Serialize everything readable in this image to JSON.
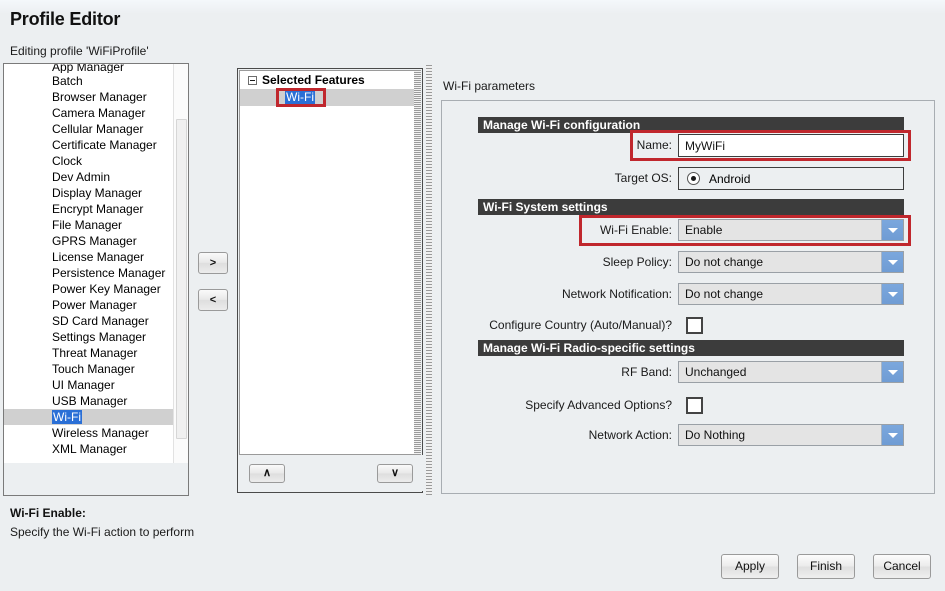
{
  "window": {
    "title": "Profile Editor",
    "subtitle": "Editing profile 'WiFiProfile'"
  },
  "feature_list": {
    "clipped_top_item": "App Manager",
    "items": [
      "Batch",
      "Browser Manager",
      "Camera Manager",
      "Cellular Manager",
      "Certificate Manager",
      "Clock",
      "Dev Admin",
      "Display Manager",
      "Encrypt Manager",
      "File Manager",
      "GPRS Manager",
      "License Manager",
      "Persistence Manager",
      "Power Key Manager",
      "Power Manager",
      "SD Card Manager",
      "Settings Manager",
      "Threat Manager",
      "Touch Manager",
      "UI Manager",
      "USB Manager",
      "Wi-Fi",
      "Wireless Manager",
      "XML Manager"
    ],
    "selected": "Wi-Fi"
  },
  "transfer": {
    "add_label": ">",
    "remove_label": "<"
  },
  "selected_features": {
    "root_label": "Selected Features",
    "children": [
      "Wi-Fi"
    ],
    "move_up_label": "∧",
    "move_down_label": "∨"
  },
  "params": {
    "title": "Wi-Fi parameters",
    "sections": [
      {
        "header": "Manage Wi-Fi configuration",
        "fields": [
          {
            "label": "Name:",
            "type": "text",
            "value": "MyWiFi",
            "highlighted": true
          },
          {
            "label": "Target OS:",
            "type": "radio",
            "value": "Android",
            "highlighted": false
          }
        ]
      },
      {
        "header": "Wi-Fi System settings",
        "fields": [
          {
            "label": "Wi-Fi Enable:",
            "type": "combo",
            "value": "Enable",
            "highlighted": true
          },
          {
            "label": "Sleep Policy:",
            "type": "combo",
            "value": "Do not change",
            "highlighted": false
          },
          {
            "label": "Network Notification:",
            "type": "combo",
            "value": "Do not change",
            "highlighted": false
          },
          {
            "label": "Configure Country (Auto/Manual)?",
            "type": "checkbox",
            "value": "",
            "checked": false,
            "highlighted": false
          }
        ]
      },
      {
        "header": "Manage Wi-Fi Radio-specific settings",
        "fields": [
          {
            "label": "RF Band:",
            "type": "combo",
            "value": "Unchanged",
            "highlighted": false
          },
          {
            "label": "Specify Advanced Options?",
            "type": "checkbox",
            "value": "",
            "checked": false,
            "highlighted": false
          },
          {
            "label": "Network Action:",
            "type": "combo",
            "value": "Do Nothing",
            "highlighted": false
          }
        ]
      }
    ]
  },
  "help": {
    "title": "Wi-Fi Enable:",
    "text": "Specify the Wi-Fi action to perform"
  },
  "footer": {
    "apply_label": "Apply",
    "finish_label": "Finish",
    "cancel_label": "Cancel"
  },
  "colors": {
    "selection_blue": "#2a6fd6",
    "section_header_bg": "#3c3c3c",
    "combo_arrow_blue": "#6f9cd4",
    "highlight_red": "#c0272d",
    "window_bg": "#eceff1"
  }
}
